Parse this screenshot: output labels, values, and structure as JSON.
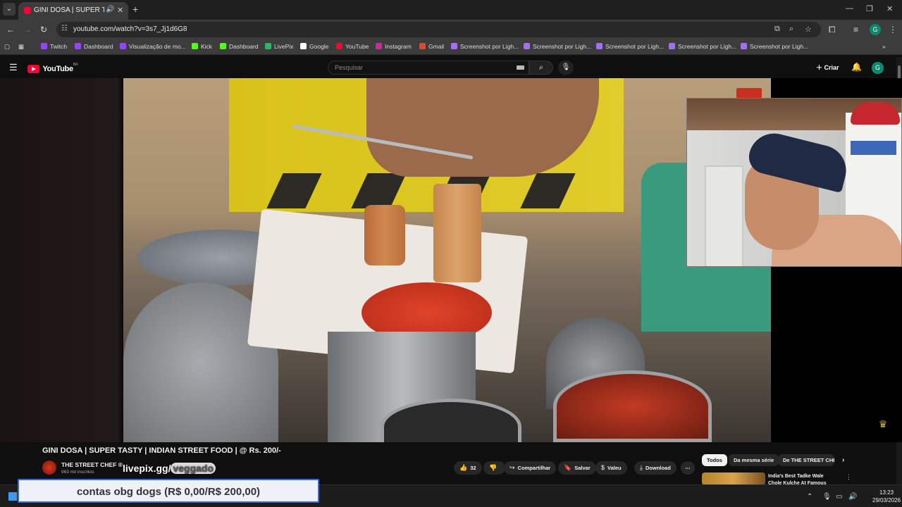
{
  "browser": {
    "tab": {
      "title": "GINI DOSA | SUPER TASTY |"
    },
    "url": "youtube.com/watch?v=3s7_Jj1d6G8",
    "bookmarks": [
      {
        "label": "Twitch",
        "color": "#9146ff"
      },
      {
        "label": "Dashboard",
        "color": "#9146ff"
      },
      {
        "label": "Visualização de mo...",
        "color": "#9146ff"
      },
      {
        "label": "Kick",
        "color": "#53fc18"
      },
      {
        "label": "Dashboard",
        "color": "#53fc18"
      },
      {
        "label": "LivePix",
        "color": "#2fb36b"
      },
      {
        "label": "Google",
        "color": "#ffffff"
      },
      {
        "label": "YouTube",
        "color": "#ff0033"
      },
      {
        "label": "Instagram",
        "color": "#d6249f"
      },
      {
        "label": "Gmail",
        "color": "#ea4335"
      },
      {
        "label": "Screenshot por Ligh...",
        "color": "#a46cff"
      },
      {
        "label": "Screenshot por Ligh...",
        "color": "#a46cff"
      },
      {
        "label": "Screenshot por Ligh...",
        "color": "#a46cff"
      },
      {
        "label": "Screenshot por Ligh...",
        "color": "#a46cff"
      },
      {
        "label": "Screenshot por Ligh...",
        "color": "#a46cff"
      }
    ],
    "profile_initial": "G"
  },
  "youtube": {
    "logo_text": "YouTube",
    "logo_sup": "BR",
    "search_placeholder": "Pesquisar",
    "create_label": "Criar",
    "avatar_initial": "G",
    "video": {
      "title": "GINI DOSA | SUPER TASTY | INDIAN STREET FOOD | @ Rs. 200/-",
      "channel": "THE STREET CHEF ®",
      "subscribers": "963 mil inscritos",
      "likes": "32",
      "actions": {
        "share": "Compartilhar",
        "save": "Salvar",
        "thanks": "Valeu",
        "download": "Download"
      }
    },
    "chips": [
      "Todos",
      "Da mesma série",
      "De THE STREET CHEF"
    ],
    "recommendation": {
      "title": "India's Best Tadke Wale Chole Kulche At Famous Mangwai"
    }
  },
  "overlays": {
    "livepix_link": "livepix.gg/",
    "livepix_tail": "veggado",
    "goal_text": "contas obg dogs (R$ 0,00/R$ 200,00)"
  },
  "taskbar": {
    "time": "13:23",
    "date": "29/03/2026"
  }
}
